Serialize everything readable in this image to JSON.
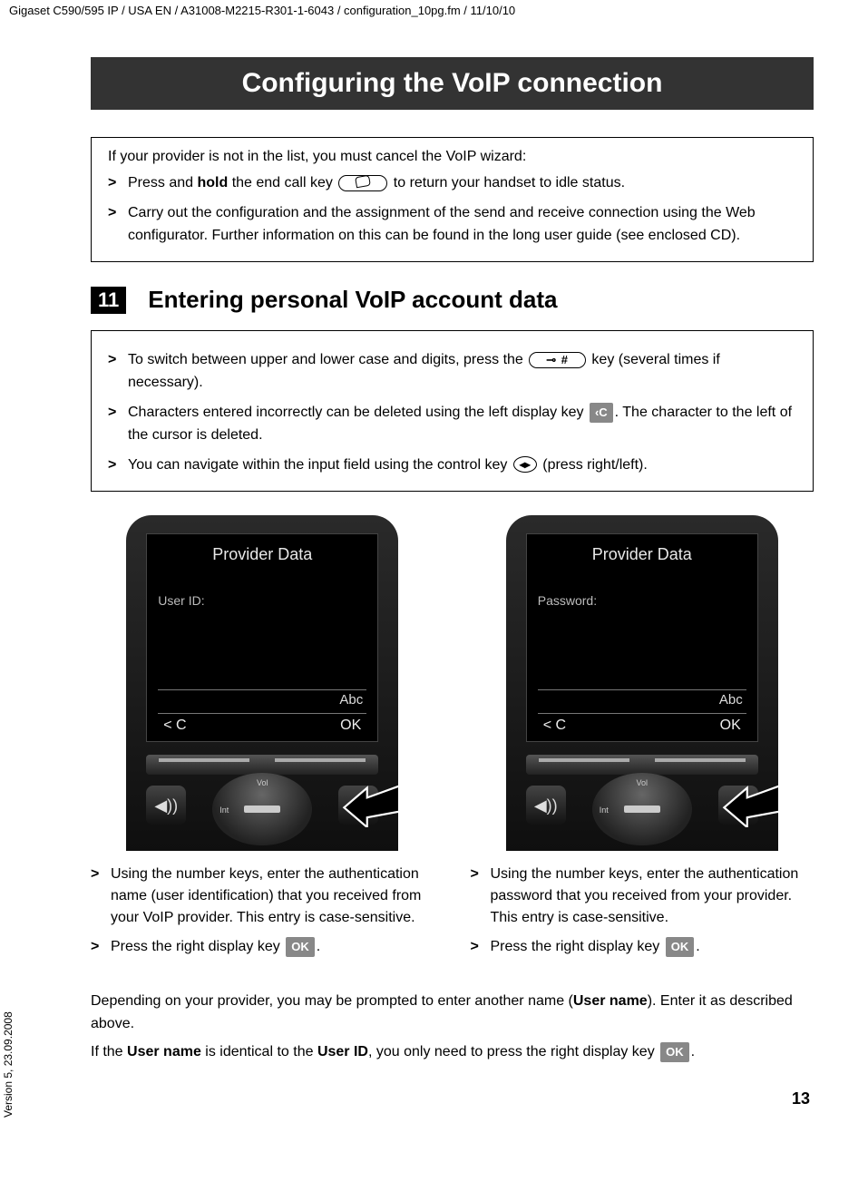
{
  "meta": {
    "header_path": "Gigaset C590/595 IP / USA EN / A31008-M2215-R301-1-6043 / configuration_10pg.fm / 11/10/10",
    "version_side": "Version 5, 23.09.2008",
    "page_number": "13"
  },
  "title": "Configuring the VoIP connection",
  "box1": {
    "lead": "If your provider is not in the list, you must cancel the VoIP wizard:",
    "items": [
      {
        "pre": "Press and ",
        "bold1": "hold",
        "mid": " the end call key ",
        "post": " to return your handset to idle status."
      },
      {
        "full": "Carry out the configuration and the assignment of the send and receive connection using the Web configurator. Further information on this can be found in the long user guide (see enclosed CD)."
      }
    ]
  },
  "step": {
    "num": "11",
    "title": "Entering personal VoIP account data"
  },
  "box2": {
    "items": [
      {
        "pre": "To switch between upper and lower case and digits, press the ",
        "key_label": "⊸ #",
        "post": " key (several times if necessary)."
      },
      {
        "pre": "Characters entered incorrectly can be deleted using the left display key ",
        "disp_key": "‹C",
        "post": ". The character to the left of the cursor is deleted."
      },
      {
        "pre": "You can navigate within the input field using the control key ",
        "post": " (press right/left)."
      }
    ]
  },
  "phones": {
    "left": {
      "screen_title": "Provider Data",
      "field_label": "User ID:",
      "mode": "Abc",
      "softkey_left": "< C",
      "softkey_right": "OK",
      "dpad_top": "Vol",
      "dpad_left": "Int"
    },
    "right": {
      "screen_title": "Provider Data",
      "field_label": "Password:",
      "mode": "Abc",
      "softkey_left": "< C",
      "softkey_right": "OK",
      "dpad_top": "Vol",
      "dpad_left": "Int"
    }
  },
  "col_left": {
    "items": [
      "Using the number keys, enter the authentication name (user identification) that you received from your VoIP provider. This entry is case-sensitive.",
      "Press the right display key "
    ],
    "ok": "OK"
  },
  "col_right": {
    "items": [
      "Using the number keys, enter the authentication password that you received from your provider. This entry is case-sensitive.",
      "Press the right display key "
    ],
    "ok": "OK"
  },
  "bottom": {
    "p1_pre": "Depending on your provider, you may be prompted to enter another name (",
    "p1_bold": "User name",
    "p1_post": "). Enter it as described above.",
    "p2_pre": "If the ",
    "p2_b1": "User name",
    "p2_mid": " is identical to the ",
    "p2_b2": "User ID",
    "p2_post": ", you only need to press the right display key ",
    "ok": "OK"
  },
  "glyphs": {
    "speaker": "◀))",
    "envelope": "✉",
    "control_arrows": "◂▸"
  }
}
